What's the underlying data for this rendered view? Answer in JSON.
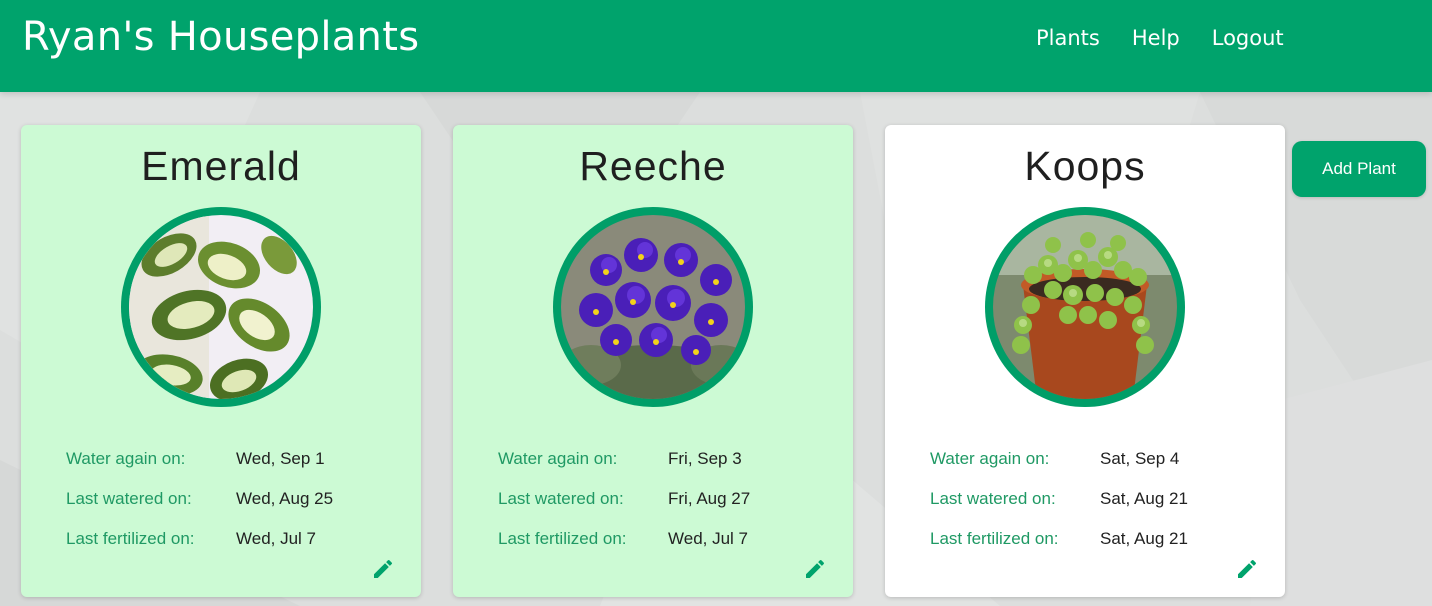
{
  "header": {
    "brand": "Ryan's Houseplants",
    "nav": [
      "Plants",
      "Help",
      "Logout"
    ]
  },
  "actions": {
    "add_plant_label": "Add Plant"
  },
  "labels": {
    "water_again": "Water again on:",
    "last_watered": "Last watered on:",
    "last_fertilized": "Last fertilized on:"
  },
  "plants": [
    {
      "name": "Emerald",
      "water_again": "Wed, Sep 1",
      "last_watered": "Wed, Aug 25",
      "last_fertilized": "Wed, Jul 7",
      "card_style": "needs-attention",
      "photo": "variegated-peperomia-photo"
    },
    {
      "name": "Reeche",
      "water_again": "Fri, Sep 3",
      "last_watered": "Fri, Aug 27",
      "last_fertilized": "Wed, Jul 7",
      "card_style": "needs-attention",
      "photo": "african-violet-photo"
    },
    {
      "name": "Koops",
      "water_again": "Sat, Sep 4",
      "last_watered": "Sat, Aug 21",
      "last_fertilized": "Sat, Aug 21",
      "card_style": "ok",
      "photo": "string-of-turtles-photo"
    }
  ],
  "colors": {
    "primary": "#00a36c",
    "card_attention": "#ccfad4",
    "card_ok": "#ffffff",
    "label_text": "#1f9964",
    "page_bg": "#dcdedd"
  }
}
